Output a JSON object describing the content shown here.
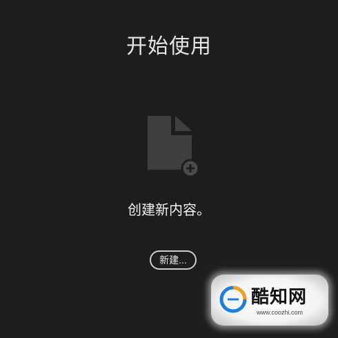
{
  "header": {
    "title": "开始使用"
  },
  "empty_state": {
    "icon": "new-document-icon",
    "message": "创建新内容。",
    "new_button_label": "新建..."
  },
  "watermark": {
    "brand": "酷知网",
    "url": "www.coozhi.com"
  },
  "colors": {
    "background": "#1d1d1d",
    "icon_fill": "#3f3f3f",
    "button_border": "#cfcfcf"
  }
}
